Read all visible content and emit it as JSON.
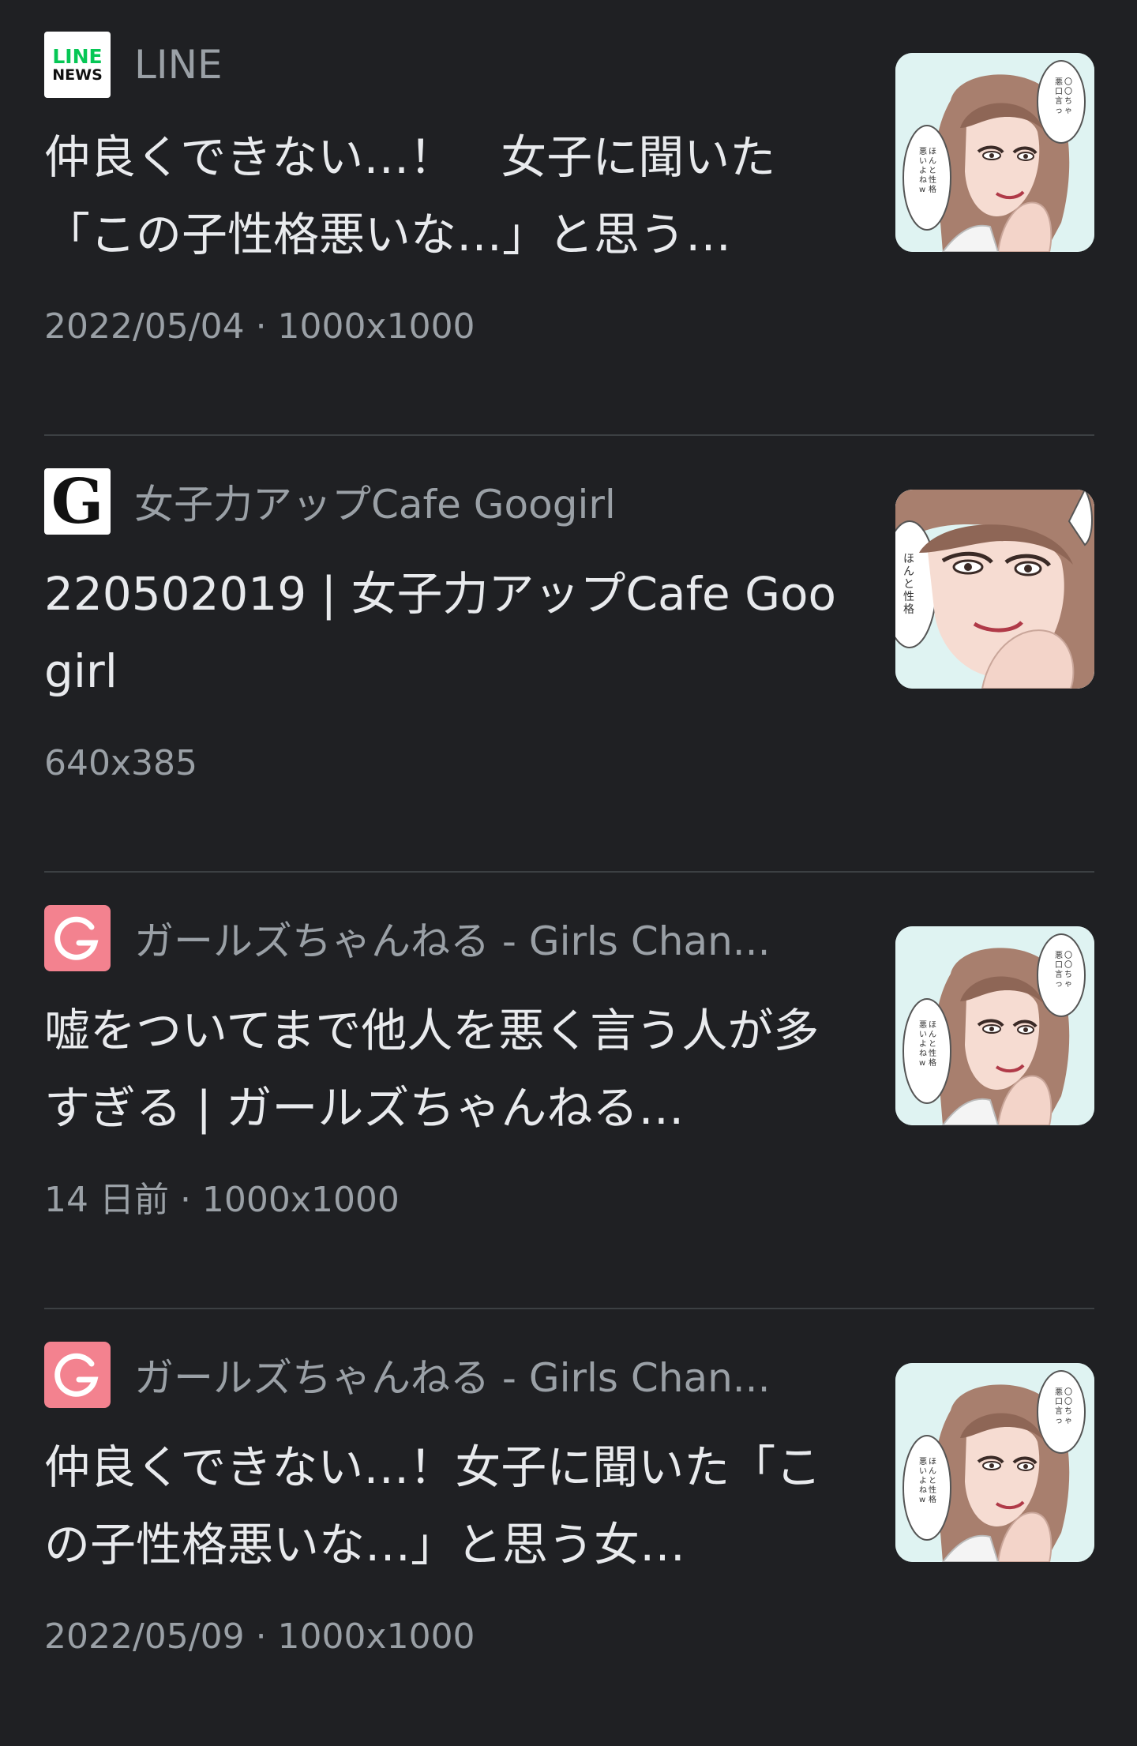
{
  "results": [
    {
      "source": "LINE",
      "favicon": "line-news-icon",
      "favicon_text": [
        "LINE",
        "NEWS"
      ],
      "title": "仲良くできない…！　女子に聞いた「この子性格悪いな…」と思う…",
      "meta": "2022/05/04 · 1000x1000",
      "thumbnail": "manga-woman-thumbnail"
    },
    {
      "source": "女子力アップCafe Googirl",
      "favicon": "googirl-g-icon",
      "favicon_text": "G",
      "title": "220502019 | 女子力アップCafe Googirl",
      "meta": "640x385",
      "thumbnail": "manga-woman-closeup-thumbnail"
    },
    {
      "source": "ガールズちゃんねる - Girls Chan...",
      "favicon": "girls-channel-g-icon",
      "title": "嘘をついてまで他人を悪く言う人が多すぎる | ガールズちゃんねる…",
      "meta": "14 日前 · 1000x1000",
      "thumbnail": "manga-woman-thumbnail"
    },
    {
      "source": "ガールズちゃんねる - Girls Chan...",
      "favicon": "girls-channel-g-icon",
      "title": "仲良くできない…！女子に聞いた「この子性格悪いな…」と思う女…",
      "meta": "2022/05/09 · 1000x1000",
      "thumbnail": "manga-woman-thumbnail"
    }
  ],
  "colors": {
    "background": "#1f2023",
    "title_text": "#e8eaed",
    "secondary_text": "#9aa0a6",
    "divider": "#3c4043",
    "line_green": "#06c755",
    "girls_channel_pink": "#f3828f"
  }
}
